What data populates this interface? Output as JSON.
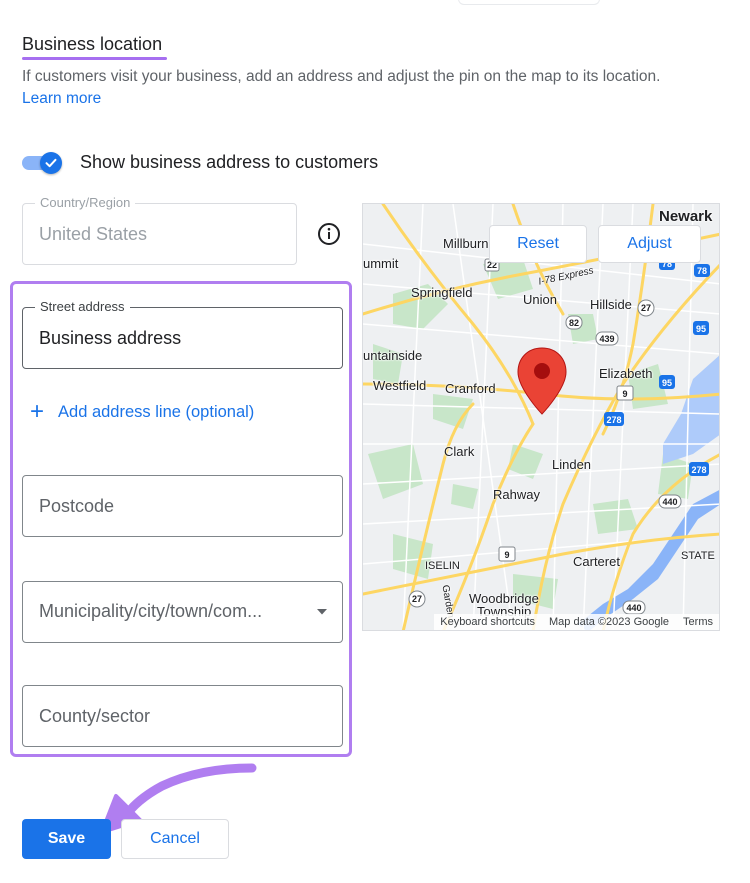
{
  "section": {
    "title": "Business location",
    "description": "If customers visit your business, add an address and adjust the pin on the map to its location.",
    "learn_more": "Learn more"
  },
  "toggle": {
    "label": "Show business address to customers",
    "checked": true
  },
  "fields": {
    "country": {
      "label": "Country/Region",
      "value": "United States",
      "disabled": true
    },
    "street": {
      "label": "Street address",
      "value": "Business address"
    },
    "add_line": "Add address line (optional)",
    "postcode": {
      "placeholder": "Postcode"
    },
    "city": {
      "placeholder": "Municipality/city/town/com..."
    },
    "county": {
      "placeholder": "County/sector"
    }
  },
  "map": {
    "reset_label": "Reset",
    "adjust_label": "Adjust",
    "places": [
      "Newark",
      "Millburn",
      "ummit",
      "Springfield",
      "Union",
      "Hillside",
      "I-78 Express",
      "untainside",
      "Westfield",
      "Cranford",
      "Elizabeth",
      "Clark",
      "Linden",
      "Rahway",
      "Carteret",
      "ISELIN",
      "Woodbridge",
      "Township",
      "STATE",
      "Garden"
    ],
    "shields": [
      "78",
      "78",
      "22",
      "27",
      "439",
      "82",
      "95",
      "9",
      "278",
      "95",
      "278",
      "440",
      "9",
      "27",
      "440"
    ],
    "footer": {
      "shortcuts": "Keyboard shortcuts",
      "map_data": "Map data ©2023 Google",
      "terms": "Terms"
    }
  },
  "actions": {
    "save": "Save",
    "cancel": "Cancel"
  },
  "colors": {
    "primary": "#1a73e8",
    "highlight": "#b07ef0",
    "pin": "#ea4335"
  }
}
